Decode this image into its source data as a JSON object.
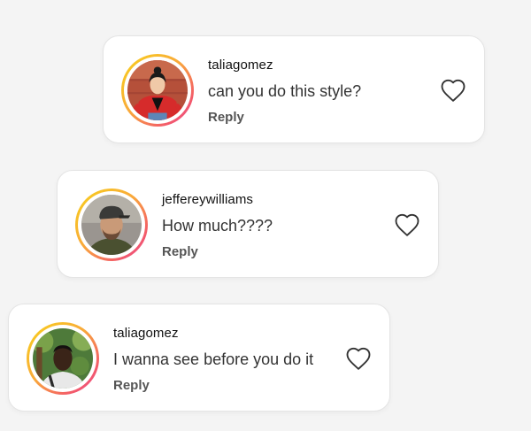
{
  "comments": [
    {
      "username": "taliagomez",
      "text": "can you do this style?",
      "reply_label": "Reply",
      "avatar_icon": "avatar-red-jacket-woman",
      "liked": false
    },
    {
      "username": "jeffereywilliams",
      "text": "How much????",
      "reply_label": "Reply",
      "avatar_icon": "avatar-cap-man",
      "liked": false
    },
    {
      "username": "taliagomez",
      "text": "I wanna see before you do it",
      "reply_label": "Reply",
      "avatar_icon": "avatar-outdoor-man",
      "liked": false
    }
  ],
  "colors": {
    "background": "#f4f4f4",
    "card": "#ffffff",
    "ring_gradient": [
      "#f7d21a",
      "#f9a93a",
      "#f35a6a",
      "#e84a9a"
    ]
  }
}
